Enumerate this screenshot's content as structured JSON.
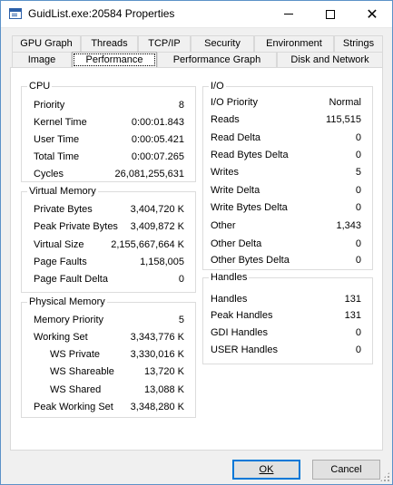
{
  "window": {
    "title": "GuidList.exe:20584 Properties"
  },
  "tabs": {
    "row1": [
      "GPU Graph",
      "Threads",
      "TCP/IP",
      "Security",
      "Environment",
      "Strings"
    ],
    "row2": [
      "Image",
      "Performance",
      "Performance Graph",
      "Disk and Network"
    ],
    "active": "Performance"
  },
  "cpu": {
    "title": "CPU",
    "rows": [
      {
        "label": "Priority",
        "value": "8"
      },
      {
        "label": "Kernel Time",
        "value": "0:00:01.843"
      },
      {
        "label": "User Time",
        "value": "0:00:05.421"
      },
      {
        "label": "Total Time",
        "value": "0:00:07.265"
      },
      {
        "label": "Cycles",
        "value": "26,081,255,631"
      }
    ]
  },
  "virtual_memory": {
    "title": "Virtual Memory",
    "rows": [
      {
        "label": "Private Bytes",
        "value": "3,404,720 K"
      },
      {
        "label": "Peak Private Bytes",
        "value": "3,409,872 K"
      },
      {
        "label": "Virtual Size",
        "value": "2,155,667,664 K"
      },
      {
        "label": "Page Faults",
        "value": "1,158,005"
      },
      {
        "label": "Page Fault Delta",
        "value": "0"
      }
    ]
  },
  "physical_memory": {
    "title": "Physical Memory",
    "rows": [
      {
        "label": "Memory Priority",
        "value": "5"
      },
      {
        "label": "Working Set",
        "value": "3,343,776 K"
      },
      {
        "label": "WS Private",
        "value": "3,330,016 K"
      },
      {
        "label": "WS Shareable",
        "value": "13,720 K"
      },
      {
        "label": "WS Shared",
        "value": "13,088 K"
      },
      {
        "label": "Peak Working Set",
        "value": "3,348,280 K"
      }
    ]
  },
  "io": {
    "title": "I/O",
    "rows": [
      {
        "label": "I/O Priority",
        "value": "Normal"
      },
      {
        "label": "Reads",
        "value": "115,515"
      },
      {
        "label": "Read Delta",
        "value": "0"
      },
      {
        "label": "Read Bytes Delta",
        "value": "0"
      },
      {
        "label": "Writes",
        "value": "5"
      },
      {
        "label": "Write Delta",
        "value": "0"
      },
      {
        "label": "Write Bytes Delta",
        "value": "0"
      },
      {
        "label": "Other",
        "value": "1,343"
      },
      {
        "label": "Other Delta",
        "value": "0"
      },
      {
        "label": "Other Bytes Delta",
        "value": "0"
      }
    ]
  },
  "handles": {
    "title": "Handles",
    "rows": [
      {
        "label": "Handles",
        "value": "131"
      },
      {
        "label": "Peak Handles",
        "value": "131"
      },
      {
        "label": "GDI Handles",
        "value": "0"
      },
      {
        "label": "USER Handles",
        "value": "0"
      }
    ]
  },
  "buttons": {
    "ok_label": "OK",
    "cancel_label": "Cancel"
  },
  "colors": {
    "accent": "#0078d7",
    "window_border": "#5c92c8"
  }
}
